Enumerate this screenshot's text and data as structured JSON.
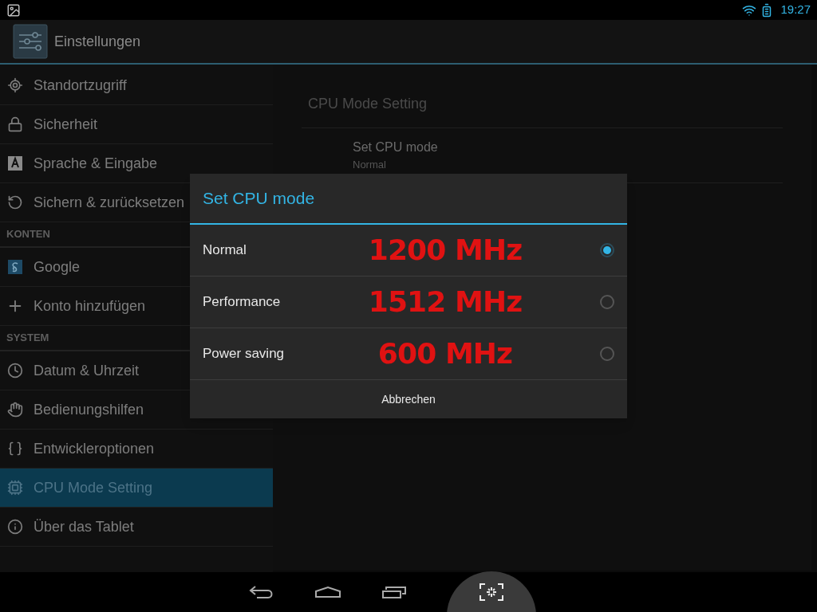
{
  "status_bar": {
    "time": "19:27"
  },
  "action_bar": {
    "title": "Einstellungen"
  },
  "sidebar": {
    "items": [
      {
        "kind": "item",
        "label": "Standortzugriff",
        "selected": false
      },
      {
        "kind": "item",
        "label": "Sicherheit",
        "selected": false
      },
      {
        "kind": "item",
        "label": "Sprache & Eingabe",
        "selected": false
      },
      {
        "kind": "item",
        "label": "Sichern & zurücksetzen",
        "selected": false
      },
      {
        "kind": "header",
        "label": "KONTEN"
      },
      {
        "kind": "item",
        "label": "Google",
        "selected": false
      },
      {
        "kind": "item",
        "label": "Konto hinzufügen",
        "selected": false
      },
      {
        "kind": "header",
        "label": "SYSTEM"
      },
      {
        "kind": "item",
        "label": "Datum & Uhrzeit",
        "selected": false
      },
      {
        "kind": "item",
        "label": "Bedienungshilfen",
        "selected": false
      },
      {
        "kind": "item",
        "label": "Entwickleroptionen",
        "selected": false
      },
      {
        "kind": "item",
        "label": "CPU Mode Setting",
        "selected": true
      },
      {
        "kind": "item",
        "label": "Über das Tablet",
        "selected": false
      }
    ]
  },
  "content": {
    "header": "CPU Mode Setting",
    "preference": {
      "title": "Set CPU mode",
      "summary": "Normal"
    }
  },
  "dialog": {
    "title": "Set CPU mode",
    "options": [
      {
        "label": "Normal",
        "frequency": "1200 MHz",
        "selected": true
      },
      {
        "label": "Performance",
        "frequency": "1512 MHz",
        "selected": false
      },
      {
        "label": "Power saving",
        "frequency": "600 MHz",
        "selected": false
      }
    ],
    "cancel": "Abbrechen"
  }
}
